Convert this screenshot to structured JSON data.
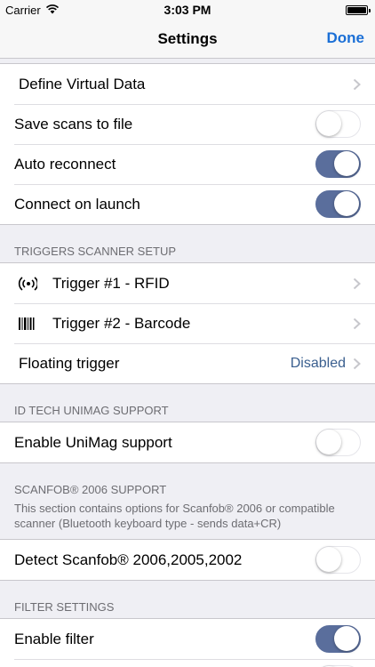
{
  "status_bar": {
    "carrier": "Carrier",
    "time": "3:03 PM",
    "wifi_icon": "wifi-icon",
    "battery_icon": "battery-icon"
  },
  "nav": {
    "title": "Settings",
    "done_label": "Done"
  },
  "group1": {
    "rows": [
      {
        "label": "Define Virtual Data",
        "kind": "chevron"
      },
      {
        "label": "Save scans to file",
        "kind": "toggle",
        "on": false
      },
      {
        "label": "Auto reconnect",
        "kind": "toggle",
        "on": true
      },
      {
        "label": "Connect on launch",
        "kind": "toggle",
        "on": true
      }
    ]
  },
  "triggers": {
    "header": "TRIGGERS SCANNER SETUP",
    "rows": [
      {
        "label": "Trigger #1 - RFID",
        "icon": "rfid-icon",
        "kind": "chevron"
      },
      {
        "label": "Trigger #2 - Barcode",
        "icon": "barcode-icon",
        "kind": "chevron"
      },
      {
        "label": "Floating trigger",
        "kind": "value-chevron",
        "value": "Disabled"
      }
    ]
  },
  "unimag": {
    "header": "ID TECH UNIMAG SUPPORT",
    "rows": [
      {
        "label": "Enable UniMag support",
        "kind": "toggle",
        "on": false
      }
    ]
  },
  "scanfob": {
    "header": "SCANFOB® 2006 SUPPORT",
    "description": "This section contains options for Scanfob® 2006 or compatible scanner (Bluetooth keyboard type - sends data+CR)",
    "rows": [
      {
        "label": "Detect Scanfob® 2006,2005,2002",
        "kind": "toggle",
        "on": false
      }
    ]
  },
  "filter": {
    "header": "FILTER SETTINGS",
    "rows": [
      {
        "label": "Enable filter",
        "kind": "toggle",
        "on": true
      },
      {
        "label": "",
        "kind": "toggle",
        "on": false
      }
    ]
  },
  "colors": {
    "accent": "#1b6fd6",
    "toggle_on": "#5a6e9c",
    "value_text": "#3a5f8f",
    "background": "#efeff4"
  }
}
